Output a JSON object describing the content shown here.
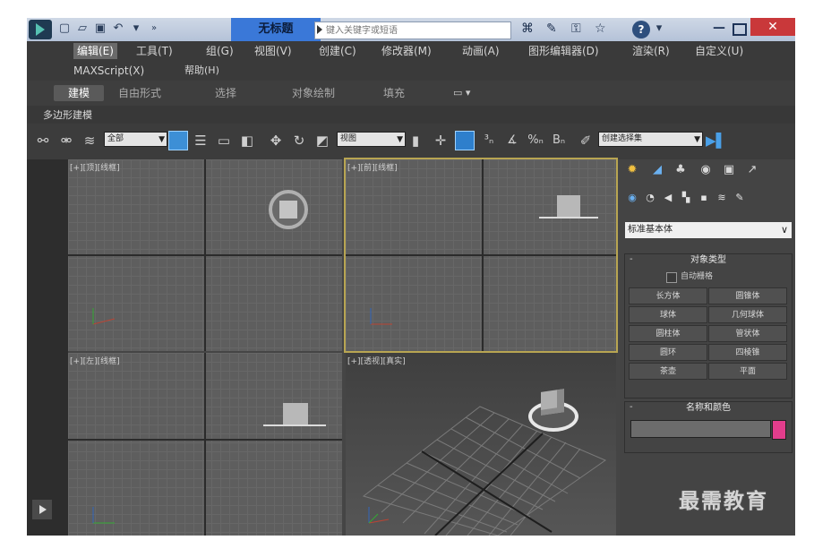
{
  "titlebar": {
    "title": "无标题",
    "search_placeholder": "键入关键字或短语",
    "help": "?"
  },
  "menu": {
    "row1": [
      "编辑(E)",
      "工具(T)",
      "组(G)",
      "视图(V)",
      "创建(C)",
      "修改器(M)",
      "动画(A)",
      "图形编辑器(D)",
      "渲染(R)",
      "自定义(U)"
    ],
    "row2": [
      "MAXScript(X)",
      "帮助(H)"
    ]
  },
  "ribbon": {
    "tabs": [
      "建模",
      "自由形式",
      "选择",
      "对象绘制",
      "填充"
    ],
    "sub_label": "多边形建模"
  },
  "toolbar": {
    "filter_value": "全部",
    "coord_value": "视图",
    "selset_value": "创建选择集"
  },
  "viewports": {
    "top": "[+][顶][线框]",
    "front": "[+][前][线框]",
    "left": "[+][左][线框]",
    "persp": "[+][透视][真实]"
  },
  "command_panel": {
    "primitive_type": "标准基本体",
    "object_type_title": "对象类型",
    "autogrid_label": "自动栅格",
    "buttons": [
      "长方体",
      "圆锥体",
      "球体",
      "几何球体",
      "圆柱体",
      "管状体",
      "圆环",
      "四棱锥",
      "茶壶",
      "平面"
    ],
    "name_color_title": "名称和颜色",
    "color": "#e23d8c"
  },
  "watermark": "最需教育",
  "colors": {
    "accent": "#3a78d8",
    "active_border": "#b8a552",
    "close": "#c9383a"
  }
}
